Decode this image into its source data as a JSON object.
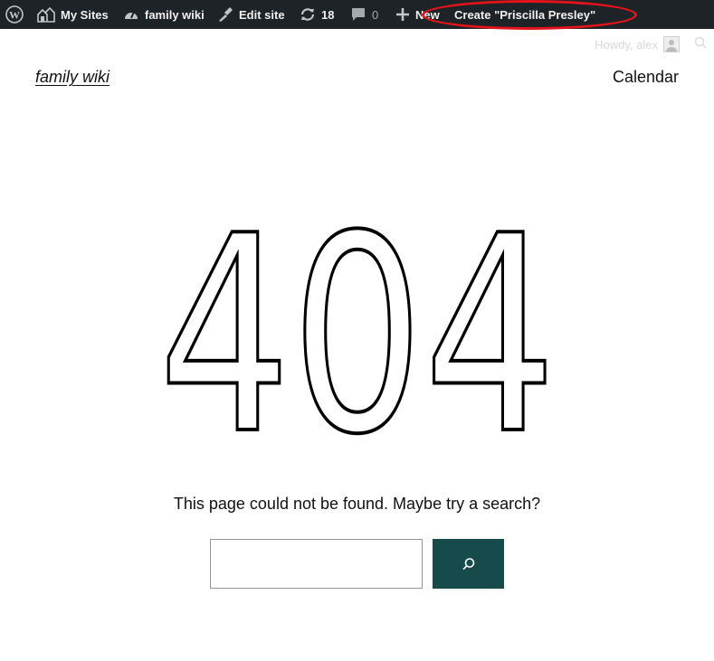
{
  "adminbar": {
    "my_sites": "My Sites",
    "site_name": "family wiki",
    "edit_site": "Edit site",
    "updates_count": "18",
    "comments_count": "0",
    "new_label": "New",
    "create_label": "Create \"Priscilla Presley\"",
    "howdy": "Howdy, alex"
  },
  "header": {
    "site_title": "family wiki",
    "nav": [
      "Calendar"
    ]
  },
  "main": {
    "heading": "404",
    "message": "This page could not be found. Maybe try a search?",
    "search_value": ""
  },
  "colors": {
    "adminbar_bg": "#1d2327",
    "button_bg": "#174a4b",
    "highlight": "#e3131b"
  }
}
